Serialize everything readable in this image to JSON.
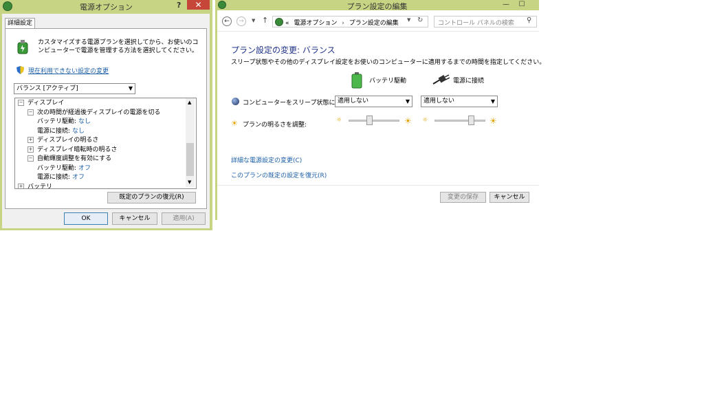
{
  "dialog": {
    "title": "電源オプション",
    "help": "?",
    "close": "✕",
    "tab": "詳細設定",
    "description": "カスタマイズする電源プランを選択してから、お使いのコンピューターで電源を管理する方法を選択してください。",
    "change_unavailable_link": "現在利用できない設定の変更",
    "plan_select": "バランス [アクティブ]",
    "tree": [
      {
        "indent": 0,
        "toggle": "⊟",
        "label": "ディスプレイ",
        "value": ""
      },
      {
        "indent": 1,
        "toggle": "⊟",
        "label": "次の時間が経過後ディスプレイの電源を切る",
        "value": ""
      },
      {
        "indent": 2,
        "toggle": "",
        "label": "バッテリ駆動:",
        "value": "なし"
      },
      {
        "indent": 2,
        "toggle": "",
        "label": "電源に接続:",
        "value": "なし"
      },
      {
        "indent": 1,
        "toggle": "⊞",
        "label": "ディスプレイの明るさ",
        "value": ""
      },
      {
        "indent": 1,
        "toggle": "⊞",
        "label": "ディスプレイ暗転時の明るさ",
        "value": ""
      },
      {
        "indent": 1,
        "toggle": "⊟",
        "label": "自動輝度調整を有効にする",
        "value": ""
      },
      {
        "indent": 2,
        "toggle": "",
        "label": "バッテリ駆動:",
        "value": "オフ"
      },
      {
        "indent": 2,
        "toggle": "",
        "label": "電源に接続:",
        "value": "オフ"
      },
      {
        "indent": 0,
        "toggle": "⊞",
        "label": "バッテリ",
        "value": ""
      }
    ],
    "restore_button": "既定のプランの復元(R)",
    "ok": "OK",
    "cancel": "キャンセル",
    "apply": "適用(A)"
  },
  "window": {
    "title": "プラン設定の編集",
    "minimize": "—",
    "maximize": "☐",
    "breadcrumb_prefix": "«",
    "breadcrumb": [
      "電源オプション",
      "プラン設定の編集"
    ],
    "search_placeholder": "コントロール パネルの検索",
    "heading": "プラン設定の変更: バランス",
    "subtitle": "スリープ状態やその他のディスプレイ設定をお使いのコンピューターに適用するまでの時間を指定してください。",
    "col_battery": "バッテリ駆動",
    "col_plugged": "電源に接続",
    "sleep_label": "コンピューターをスリープ状態にする:",
    "sleep_battery": "適用しない",
    "sleep_plugged": "適用しない",
    "brightness_label": "プランの明るさを調整:",
    "brightness_battery_pct": 40,
    "brightness_plugged_pct": 75,
    "advanced_link": "詳細な電源設定の変更(C)",
    "restore_link": "このプランの既定の設定を復元(R)",
    "save": "変更の保存",
    "cancel": "キャンセル"
  }
}
